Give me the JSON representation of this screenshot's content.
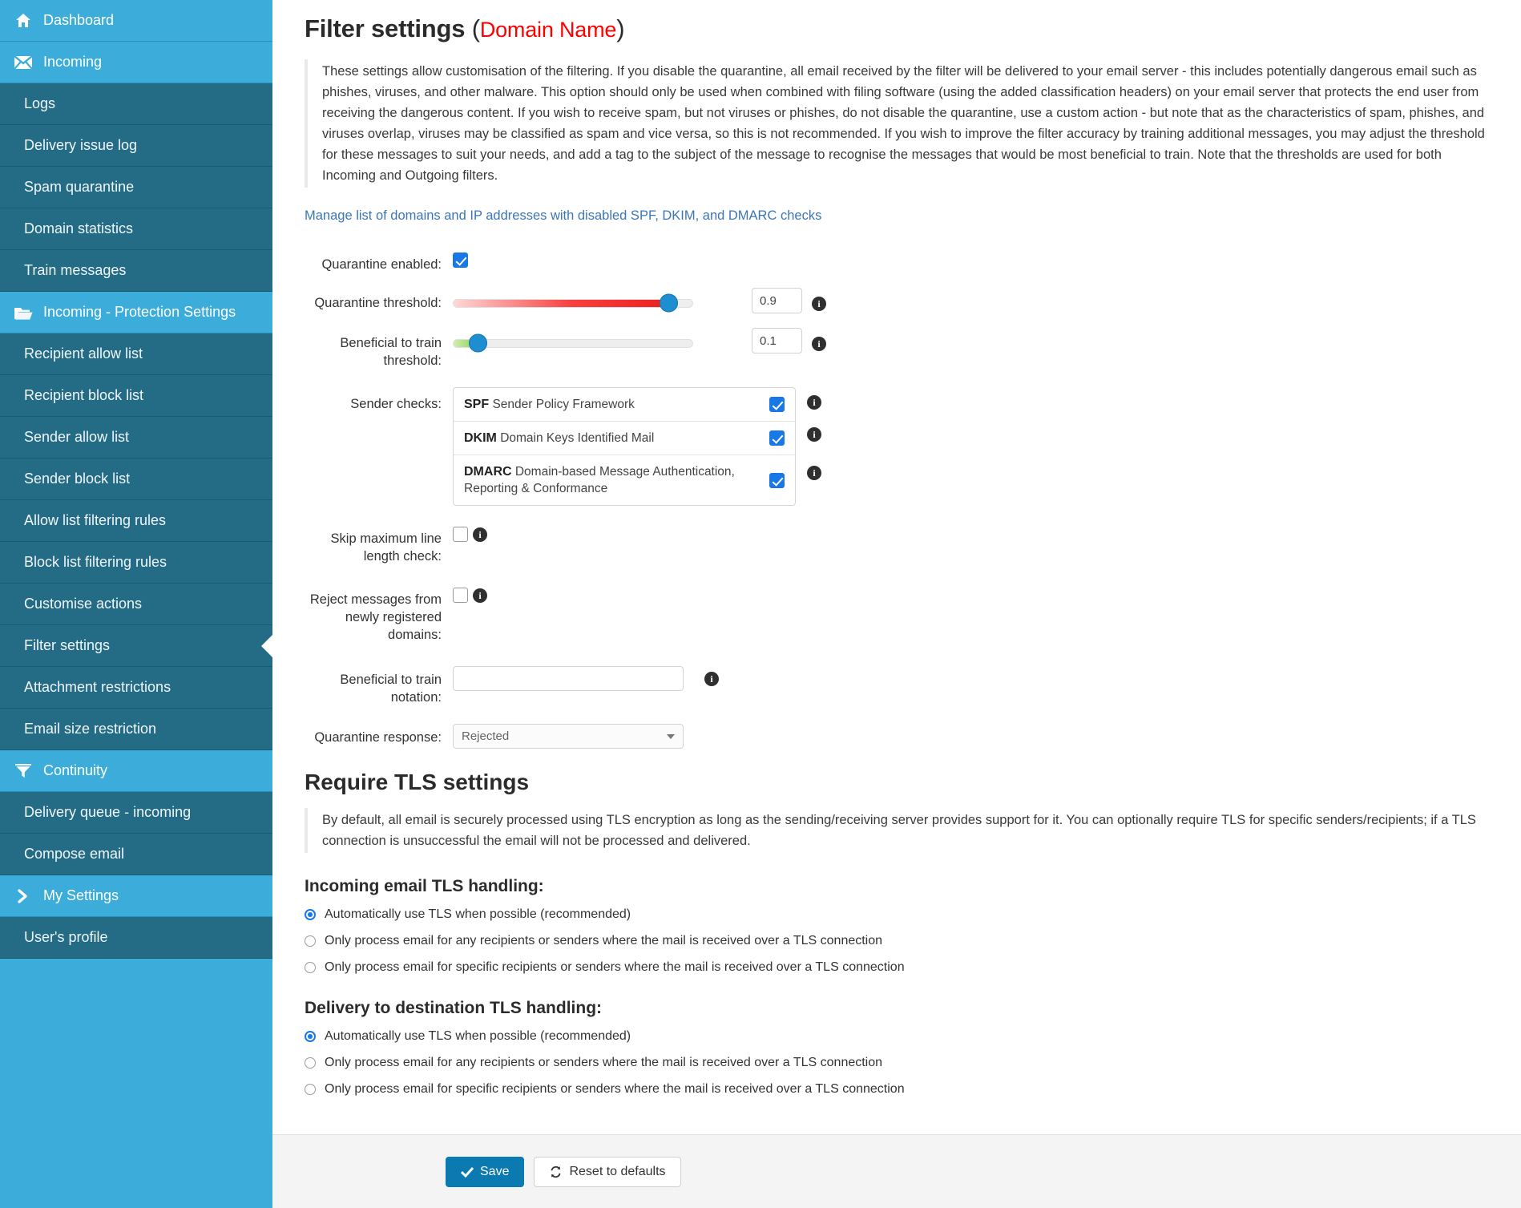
{
  "sidebar": {
    "items": [
      {
        "label": "Dashboard",
        "type": "head",
        "icon": "home-icon"
      },
      {
        "label": "Incoming",
        "type": "head",
        "icon": "envelope-icon"
      },
      {
        "label": "Logs",
        "type": "sub"
      },
      {
        "label": "Delivery issue log",
        "type": "sub"
      },
      {
        "label": "Spam quarantine",
        "type": "sub"
      },
      {
        "label": "Domain statistics",
        "type": "sub"
      },
      {
        "label": "Train messages",
        "type": "sub"
      },
      {
        "label": "Incoming - Protection Settings",
        "type": "head",
        "icon": "folder-open-icon"
      },
      {
        "label": "Recipient allow list",
        "type": "sub"
      },
      {
        "label": "Recipient block list",
        "type": "sub"
      },
      {
        "label": "Sender allow list",
        "type": "sub"
      },
      {
        "label": "Sender block list",
        "type": "sub"
      },
      {
        "label": "Allow list filtering rules",
        "type": "sub"
      },
      {
        "label": "Block list filtering rules",
        "type": "sub"
      },
      {
        "label": "Customise actions",
        "type": "sub"
      },
      {
        "label": "Filter settings",
        "type": "sub",
        "active": true
      },
      {
        "label": "Attachment restrictions",
        "type": "sub"
      },
      {
        "label": "Email size restriction",
        "type": "sub"
      },
      {
        "label": "Continuity",
        "type": "head",
        "icon": "funnel-icon"
      },
      {
        "label": "Delivery queue - incoming",
        "type": "sub"
      },
      {
        "label": "Compose email",
        "type": "sub"
      },
      {
        "label": "My Settings",
        "type": "head",
        "icon": "chevron-right-icon"
      },
      {
        "label": "User's profile",
        "type": "sub"
      }
    ]
  },
  "page": {
    "title": "Filter settings",
    "paren_open": "(",
    "paren_close": ")",
    "domain": "Domain Name",
    "intro": "These settings allow customisation of the filtering. If you disable the quarantine, all email received by the filter will be delivered to your email server - this includes potentially dangerous email such as phishes, viruses, and other malware. This option should only be used when combined with filing software (using the added classification headers) on your email server that protects the end user from receiving the dangerous content. If you wish to receive spam, but not viruses or phishes, do not disable the quarantine, use a custom action - but note that as the characteristics of spam, phishes, and viruses overlap, viruses may be classified as spam and vice versa, so this is not recommended. If you wish to improve the filter accuracy by training additional messages, you may adjust the threshold for these messages to suit your needs, and add a tag to the subject of the message to recognise the messages that would be most beneficial to train. Note that the thresholds are used for both Incoming and Outgoing filters.",
    "manage_link": "Manage list of domains and IP addresses with disabled SPF, DKIM, and DMARC checks"
  },
  "form": {
    "quarantine_enabled": {
      "label": "Quarantine enabled:",
      "checked": true
    },
    "quarantine_threshold": {
      "label": "Quarantine threshold:",
      "value": "0.9",
      "percent": 90,
      "color": "#f84040"
    },
    "train_threshold": {
      "label": "Beneficial to train threshold:",
      "value": "0.1",
      "percent": 10,
      "color": "#8fd04f"
    },
    "sender_checks": {
      "label": "Sender checks:",
      "rows": [
        {
          "abbr": "SPF",
          "desc": "Sender Policy Framework",
          "checked": true
        },
        {
          "abbr": "DKIM",
          "desc": "Domain Keys Identified Mail",
          "checked": true
        },
        {
          "abbr": "DMARC",
          "desc": "Domain-based Message Authentication, Reporting & Conformance",
          "checked": true
        }
      ]
    },
    "skip_line_length": {
      "label": "Skip maximum line length check:",
      "checked": false
    },
    "reject_new_domains": {
      "label": "Reject messages from newly registered domains:",
      "checked": false
    },
    "train_notation": {
      "label": "Beneficial to train notation:",
      "value": "",
      "placeholder": ""
    },
    "quarantine_response": {
      "label": "Quarantine response:",
      "value": "Rejected"
    }
  },
  "tls": {
    "section_title": "Require TLS settings",
    "note": "By default, all email is securely processed using TLS encryption as long as the sending/receiving server provides support for it. You can optionally require TLS for specific senders/recipients; if a TLS connection is unsuccessful the email will not be processed and delivered.",
    "incoming": {
      "title": "Incoming email TLS handling:",
      "options": [
        {
          "label": "Automatically use TLS when possible (recommended)",
          "selected": true
        },
        {
          "label": "Only process email for any recipients or senders where the mail is received over a TLS connection",
          "selected": false
        },
        {
          "label": "Only process email for specific recipients or senders where the mail is received over a TLS connection",
          "selected": false
        }
      ]
    },
    "delivery": {
      "title": "Delivery to destination TLS handling:",
      "options": [
        {
          "label": "Automatically use TLS when possible (recommended)",
          "selected": true
        },
        {
          "label": "Only process email for any recipients or senders where the mail is received over a TLS connection",
          "selected": false
        },
        {
          "label": "Only process email for specific recipients or senders where the mail is received over a TLS connection",
          "selected": false
        }
      ]
    }
  },
  "footer": {
    "save_label": "Save",
    "reset_label": "Reset to defaults"
  },
  "colors": {
    "sidebar_head": "#3cadda",
    "sidebar_sub": "#246c86",
    "accent_link": "#3a76b8",
    "domain_red": "#ff0000",
    "save_button": "#0a7ab0",
    "checkbox_blue": "#1878e6"
  }
}
